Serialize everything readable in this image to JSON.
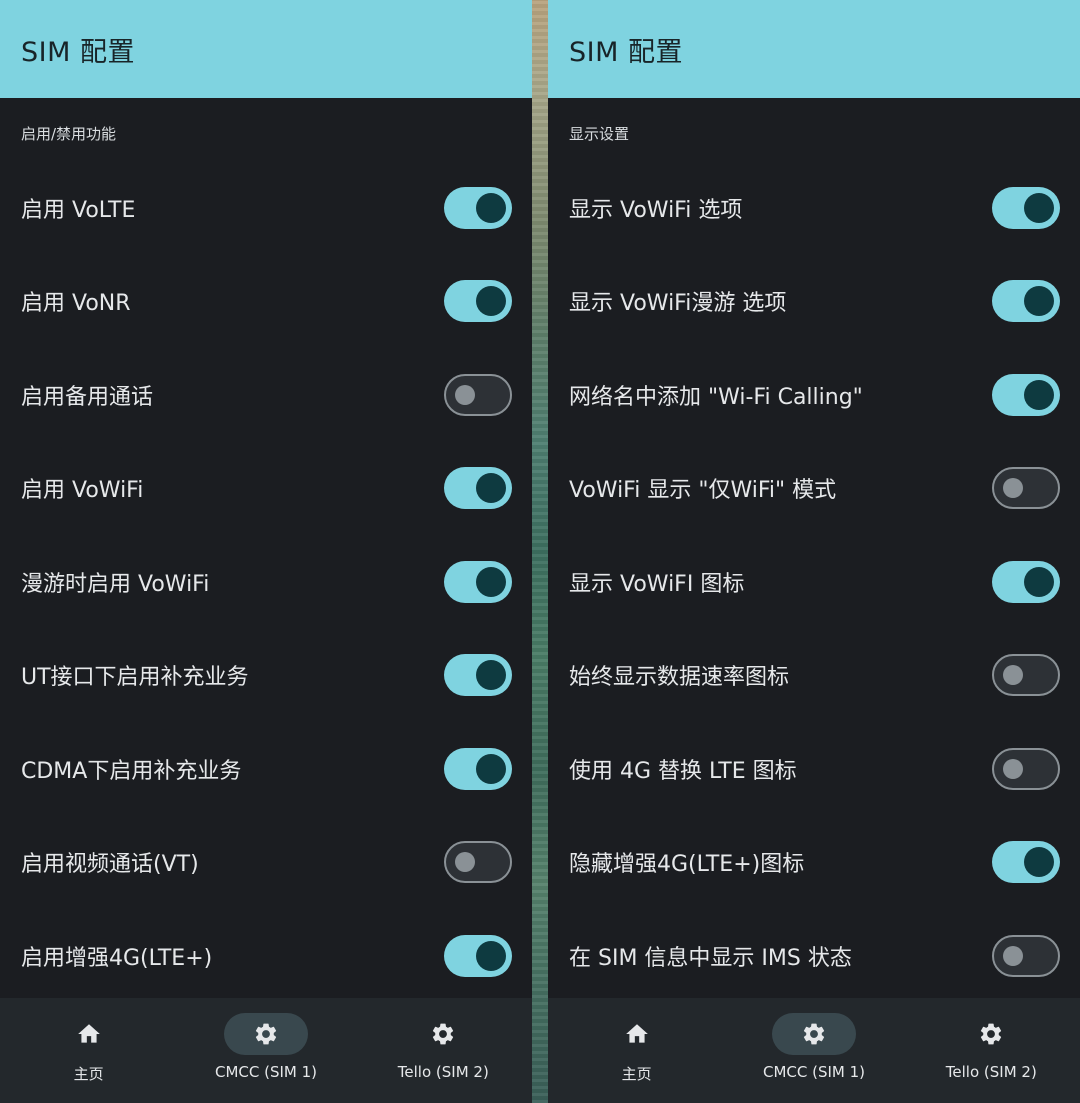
{
  "left_panel": {
    "title": "SIM 配置",
    "section_header": "启用/禁用功能",
    "settings": [
      {
        "label": "启用 VoLTE",
        "enabled": true
      },
      {
        "label": "启用 VoNR",
        "enabled": true
      },
      {
        "label": "启用备用通话",
        "enabled": false
      },
      {
        "label": "启用 VoWiFi",
        "enabled": true
      },
      {
        "label": "漫游时启用 VoWiFi",
        "enabled": true
      },
      {
        "label": "UT接口下启用补充业务",
        "enabled": true
      },
      {
        "label": "CDMA下启用补充业务",
        "enabled": true
      },
      {
        "label": "启用视频通话(VT)",
        "enabled": false
      },
      {
        "label": "启用增强4G(LTE+)",
        "enabled": true
      }
    ]
  },
  "right_panel": {
    "title": "SIM 配置",
    "section_header": "显示设置",
    "settings": [
      {
        "label": "显示 VoWiFi 选项",
        "enabled": true
      },
      {
        "label": "显示 VoWiFi漫游 选项",
        "enabled": true
      },
      {
        "label": "网络名中添加 \"Wi-Fi Calling\"",
        "enabled": true
      },
      {
        "label": "VoWiFi 显示 \"仅WiFi\" 模式",
        "enabled": false
      },
      {
        "label": "显示 VoWiFI 图标",
        "enabled": true
      },
      {
        "label": "始终显示数据速率图标",
        "enabled": false
      },
      {
        "label": "使用 4G 替换 LTE 图标",
        "enabled": false
      },
      {
        "label": "隐藏增强4G(LTE+)图标",
        "enabled": true
      },
      {
        "label": "在 SIM 信息中显示 IMS 状态",
        "enabled": false
      }
    ]
  },
  "bottom_nav": [
    {
      "label": "主页",
      "icon": "home-icon",
      "active": false
    },
    {
      "label": "CMCC (SIM 1)",
      "icon": "gear-icon",
      "active": true
    },
    {
      "label": "Tello (SIM 2)",
      "icon": "gear-icon",
      "active": false
    }
  ],
  "colors": {
    "accent": "#7fd3e0",
    "background": "#1b1d21",
    "switch_thumb_on": "#0e3a40",
    "switch_off_outline": "#8a9196",
    "nav_background": "#23282c",
    "nav_active_pill": "#39484e"
  }
}
